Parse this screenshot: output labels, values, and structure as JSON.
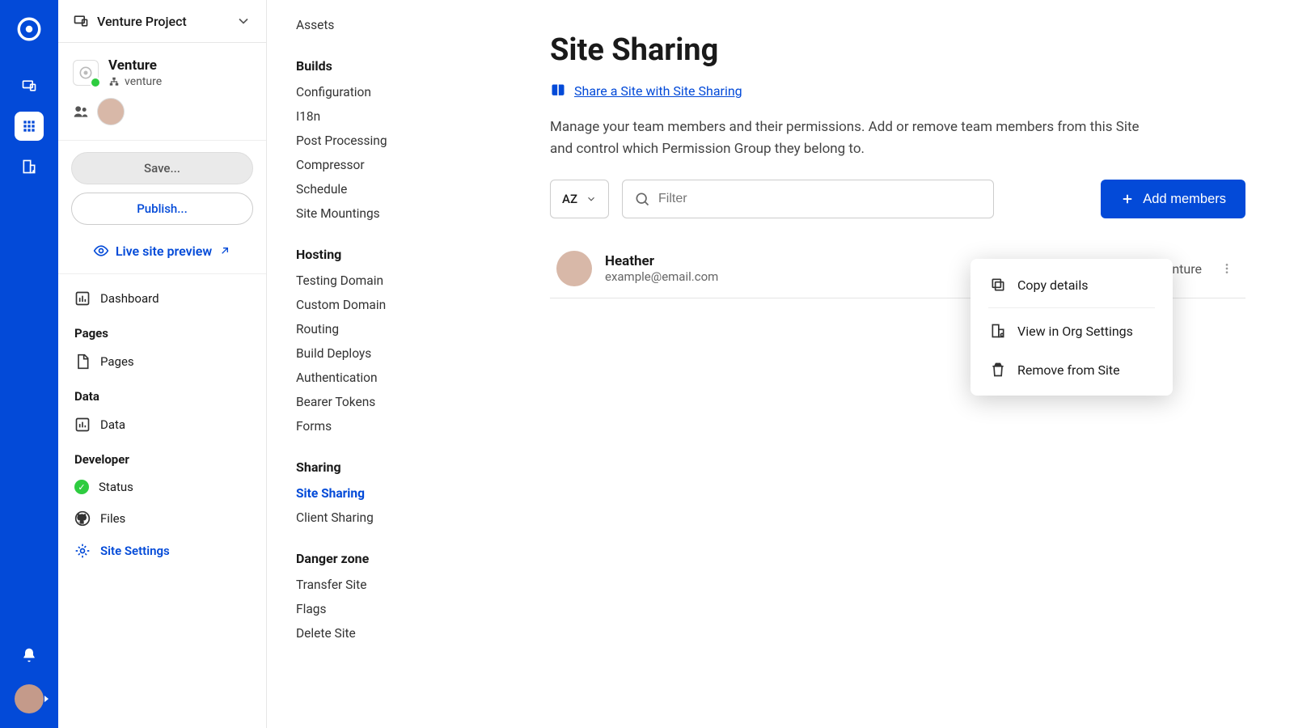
{
  "project": {
    "name": "Venture Project"
  },
  "org": {
    "title": "Venture",
    "slug": "venture"
  },
  "sidebar": {
    "save": "Save...",
    "publish": "Publish...",
    "livePreview": "Live site preview",
    "items": {
      "dashboard": "Dashboard",
      "pages_section": "Pages",
      "pages": "Pages",
      "data_section": "Data",
      "data": "Data",
      "developer_section": "Developer",
      "status": "Status",
      "files": "Files",
      "siteSettings": "Site Settings"
    }
  },
  "settings": {
    "assets": "Assets",
    "builds_title": "Builds",
    "configuration": "Configuration",
    "i18n": "I18n",
    "postProcessing": "Post Processing",
    "compressor": "Compressor",
    "schedule": "Schedule",
    "siteMountings": "Site Mountings",
    "hosting_title": "Hosting",
    "testingDomain": "Testing Domain",
    "customDomain": "Custom Domain",
    "routing": "Routing",
    "buildDeploys": "Build Deploys",
    "authentication": "Authentication",
    "bearerTokens": "Bearer Tokens",
    "forms": "Forms",
    "sharing_title": "Sharing",
    "siteSharing": "Site Sharing",
    "clientSharing": "Client Sharing",
    "danger_title": "Danger zone",
    "transferSite": "Transfer Site",
    "flags": "Flags",
    "deleteSite": "Delete Site"
  },
  "main": {
    "title": "Site Sharing",
    "docLink": "Share a Site with Site Sharing",
    "description": "Manage your team members and their permissions. Add or remove team members from this Site and control which Permission Group they belong to.",
    "sortLabel": "AZ",
    "filterPlaceholder": "Filter",
    "addMembers": "Add members"
  },
  "member": {
    "name": "Heather",
    "email": "example@email.com",
    "group": "Venture"
  },
  "popover": {
    "copy": "Copy details",
    "view": "View in Org Settings",
    "remove": "Remove from Site"
  }
}
